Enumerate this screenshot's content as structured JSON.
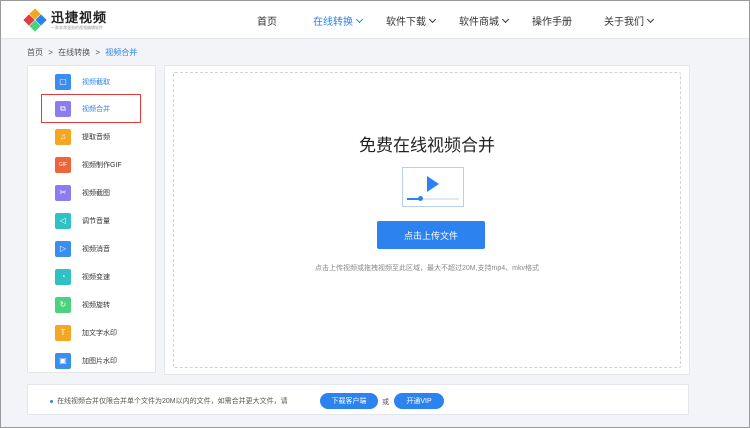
{
  "header": {
    "logo_title": "迅捷视频",
    "logo_sub": "一款非常强劲的视频编辑软件",
    "nav": [
      {
        "label": "首页",
        "has_dropdown": false,
        "active": false
      },
      {
        "label": "在线转换",
        "has_dropdown": true,
        "active": true
      },
      {
        "label": "软件下载",
        "has_dropdown": true,
        "active": false
      },
      {
        "label": "软件商城",
        "has_dropdown": true,
        "active": false
      },
      {
        "label": "操作手册",
        "has_dropdown": false,
        "active": false
      },
      {
        "label": "关于我们",
        "has_dropdown": true,
        "active": false
      }
    ]
  },
  "breadcrumb": {
    "items": [
      "首页",
      ">",
      "在线转换",
      ">",
      "视频合并"
    ]
  },
  "sidebar": {
    "items": [
      {
        "label": "视频截取",
        "icon": "crop-icon",
        "color": "#3a8ef0"
      },
      {
        "label": "视频合并",
        "icon": "merge-icon",
        "color": "#8b7df0"
      },
      {
        "label": "提取音频",
        "icon": "headphone-icon",
        "color": "#f5a623"
      },
      {
        "label": "视频制作GIF",
        "icon": "gif-icon",
        "color": "#f0643a"
      },
      {
        "label": "视频截图",
        "icon": "scissors-icon",
        "color": "#8b7df0"
      },
      {
        "label": "调节音量",
        "icon": "volume-icon",
        "color": "#2fc2c2"
      },
      {
        "label": "视频消音",
        "icon": "mute-icon",
        "color": "#3a8ef0"
      },
      {
        "label": "视频变速",
        "icon": "speed-icon",
        "color": "#2fc2c2"
      },
      {
        "label": "视频旋转",
        "icon": "rotate-icon",
        "color": "#4cd27a"
      },
      {
        "label": "加文字水印",
        "icon": "text-watermark-icon",
        "color": "#f5a623"
      },
      {
        "label": "加图片水印",
        "icon": "image-watermark-icon",
        "color": "#3a8ef0"
      }
    ]
  },
  "main": {
    "title": "免费在线视频合并",
    "upload_label": "点击上传文件",
    "hint": "点击上传视频或拖拽视频至此区域，最大不超过20M,支持mp4、mkv格式",
    "progress": 0.25
  },
  "footer": {
    "note": "在线视频合并仅限合并单个文件为20M以内的文件，如需合并更大文件，请",
    "download_label": "下载客户端",
    "or_text": "或",
    "vip_label": "开通VIP"
  },
  "colors": {
    "accent": "#2c83f0",
    "highlight_border": "#e23b3b"
  }
}
